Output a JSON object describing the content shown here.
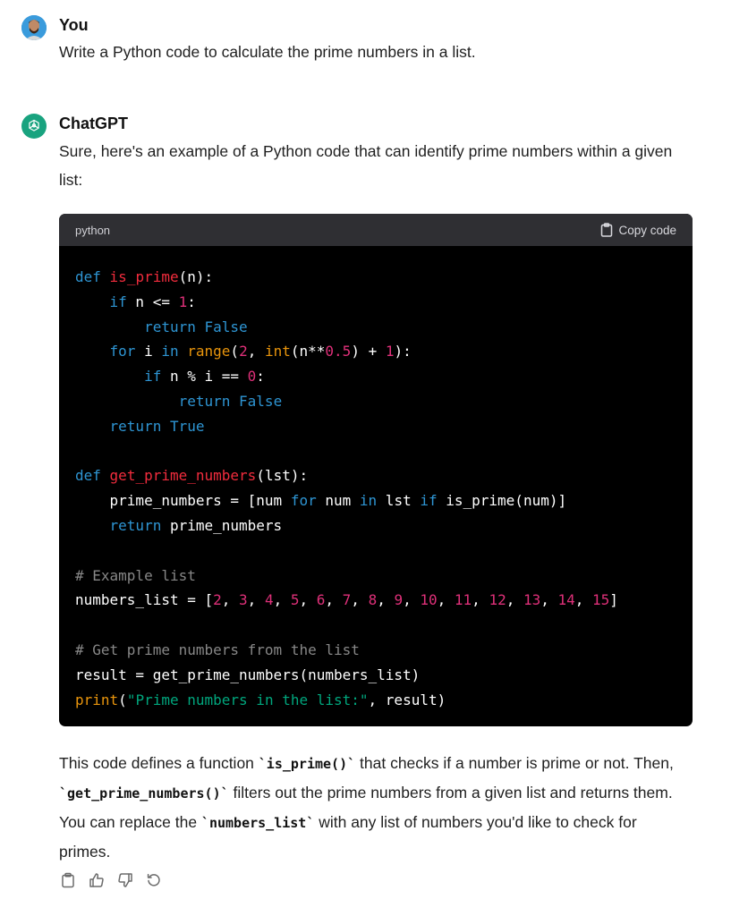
{
  "user_message": {
    "author": "You",
    "text": "Write a Python code to calculate the prime numbers in a list."
  },
  "assistant_message": {
    "author": "ChatGPT",
    "intro": "Sure, here's an example of a Python code that can identify prime numbers within a given list:",
    "code_block": {
      "language": "python",
      "copy_label": "Copy code"
    },
    "explanation": {
      "p1": "This code defines a function ",
      "c1": "`is_prime()`",
      "p2": " that checks if a number is prime or not. Then, ",
      "c2": "`get_prime_numbers()`",
      "p3": " filters out the prime numbers from a given list and returns them. You can replace the ",
      "c3": "`numbers_list`",
      "p4": " with any list of numbers you'd like to check for primes."
    }
  },
  "action_icons": [
    "clipboard-icon",
    "thumbs-up-icon",
    "thumbs-down-icon",
    "regenerate-icon"
  ],
  "colors": {
    "code_keyword": "#2e95d3",
    "code_function": "#f22c3d",
    "code_number": "#df3079",
    "code_builtin": "#e9950c",
    "code_string": "#00a67d",
    "gpt_avatar": "#19a37f"
  }
}
